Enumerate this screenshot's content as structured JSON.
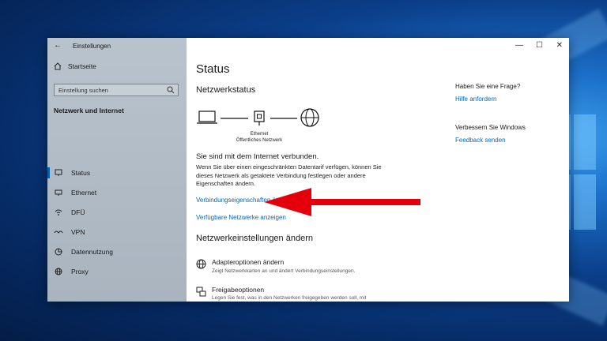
{
  "app_title": "Einstellungen",
  "sidebar": {
    "home_label": "Startseite",
    "search_placeholder": "Einstellung suchen",
    "section_title": "Netzwerk und Internet",
    "items": [
      {
        "label": "Status",
        "icon": "status-icon"
      },
      {
        "label": "Ethernet",
        "icon": "ethernet-icon"
      },
      {
        "label": "DFÜ",
        "icon": "dialup-icon"
      },
      {
        "label": "VPN",
        "icon": "vpn-icon"
      },
      {
        "label": "Datennutzung",
        "icon": "data-usage-icon"
      },
      {
        "label": "Proxy",
        "icon": "globe-icon"
      }
    ]
  },
  "window_controls": {
    "minimize": "—",
    "maximize": "☐",
    "close": "✕"
  },
  "main": {
    "title": "Status",
    "network_status_heading": "Netzwerkstatus",
    "diagram": {
      "adapter_name": "Ethernet",
      "network_type": "Öffentliches Netzwerk"
    },
    "connected_text": "Sie sind mit dem Internet verbunden.",
    "description": "Wenn Sie über einen eingeschränkten Datentarif verfügen, können Sie dieses Netzwerk als getaktete Verbindung festlegen oder andere Eigenschaften ändern.",
    "link_properties": "Verbindungseigenschaften ändern",
    "link_available_networks": "Verfügbare Netzwerke anzeigen",
    "change_settings_heading": "Netzwerkeinstellungen ändern",
    "options": [
      {
        "title": "Adapteroptionen ändern",
        "subtitle": "Zeigt Netzwerkkarten an und ändert Verbindungseinstellungen."
      },
      {
        "title": "Freigabeoptionen",
        "subtitle": "Legen Sie fest, was in den Netzwerken freigegeben werden soll, mit"
      }
    ]
  },
  "right_panel": {
    "question": "Haben Sie eine Frage?",
    "help_link": "Hilfe anfordern",
    "improve": "Verbessern Sie Windows",
    "feedback_link": "Feedback senden"
  },
  "colors": {
    "accent": "#0067c0",
    "annotation_arrow": "#e3000b"
  }
}
